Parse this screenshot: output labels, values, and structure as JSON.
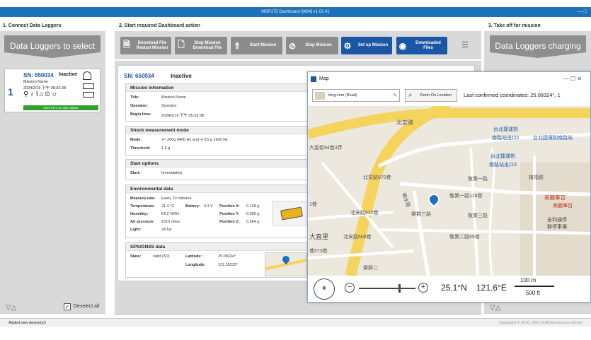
{
  "window": {
    "title": "MSR175 Dashboard [W64] v1.02.41",
    "controls": "— □"
  },
  "columns": {
    "connect": "1. Connect Data Loggers",
    "action": "2. Start required Dashboard action",
    "takeoff": "3. Take off for mission"
  },
  "left": {
    "banner": "Data Loggers to select",
    "card": {
      "index": "1",
      "sn": "SN: 650034",
      "state": "Inactive",
      "mission_name": "Mission Name",
      "date": "2024/2/19 下午 05:33:38",
      "view_link": "Click here to view values"
    },
    "deselect": "Deselect all"
  },
  "toolbar": {
    "download_restart": [
      "Download File",
      "Restart Mission"
    ],
    "stop_download": [
      "Stop Mission",
      "Download File"
    ],
    "start": "Start Mission",
    "stop": "Stop Mission",
    "setup": "Set up Mission",
    "downloaded": [
      "Downloaded",
      "Files"
    ]
  },
  "right": {
    "banner": "Data Loggers charging"
  },
  "detail": {
    "sn": "SN: 650034",
    "state": "Inactive",
    "mission": {
      "header": "Mission information",
      "title_k": "Title:",
      "title_v": "Mission Name",
      "operator_k": "Operator:",
      "operator_v": "Operator",
      "begin_k": "Begin time:",
      "begin_v": "2024/2/19 下午 05:33:38"
    },
    "shock": {
      "header": "Shock measurement mode",
      "mode_k": "Mode:",
      "mode_v": "+/- 200g 6400 Hz and +/-15 g 1600 Hz",
      "threshold_k": "Threshold:",
      "threshold_v": "1.5 g"
    },
    "start": {
      "header": "Start options",
      "start_k": "Start:",
      "start_v": "Immediately"
    },
    "env": {
      "header": "Environmental data",
      "rate_k": "Measure rate:",
      "rate_v": "Every 10 minutes",
      "temp_k": "Temperature:",
      "temp_v": "21.4 °C",
      "battery_k": "Battery:",
      "battery_v": "4.3 V",
      "posx_k": "Position X:",
      "posx_v": "0.128 g",
      "hum_k": "Humidity:",
      "hum_v": "64.2 %RH",
      "posy_k": "Position Y:",
      "posy_v": "0.000 g",
      "air_k": "Air pressure:",
      "air_v": "1010 mbar",
      "posz_k": "Position Z:",
      "posz_v": "0.664 g",
      "light_k": "Light:",
      "light_v": "24 lux"
    },
    "gps": {
      "header": "GPS/GNSS data",
      "state_k": "State:",
      "state_v": "valid (3D)",
      "lat_k": "Latitude:",
      "lat_v": "25.08324°",
      "lon_k": "Longitude:",
      "lon_v": "121.55225°"
    }
  },
  "map": {
    "title": "Map",
    "controls": "—   ☐   ✕",
    "source": "bing.com (Road)",
    "zoom_btn": "Zoom On Location",
    "last_coords": "Last confirmed coordinates:  25.08324°, 1",
    "lat": "25.1°N",
    "lon": "121.6°E",
    "scale_m": "100 m",
    "scale_ft": "500 ft",
    "labels": [
      "北安路",
      "台北捷運劍",
      "南路站出口1",
      "台北捷運劍南路站",
      "台北捷運劍",
      "南路站出口3",
      "大直街94巷3弄",
      "北安路670巷",
      "敬業一路",
      "植福路",
      "敬業一路128巷",
      "明水路",
      "北安路630巷",
      "樂群三路",
      "敬業三路",
      "美麗華百",
      "美麗華百",
      "全利通停",
      "群停車場",
      "大直里",
      "北安路608巷",
      "敬業二路69巷",
      "1巷",
      "巷573巷",
      "樂群二"
    ]
  },
  "status": {
    "left": "Added new device(s)!",
    "right": "Copyright © 2016, 2021 MSR Electronics GmbH"
  }
}
